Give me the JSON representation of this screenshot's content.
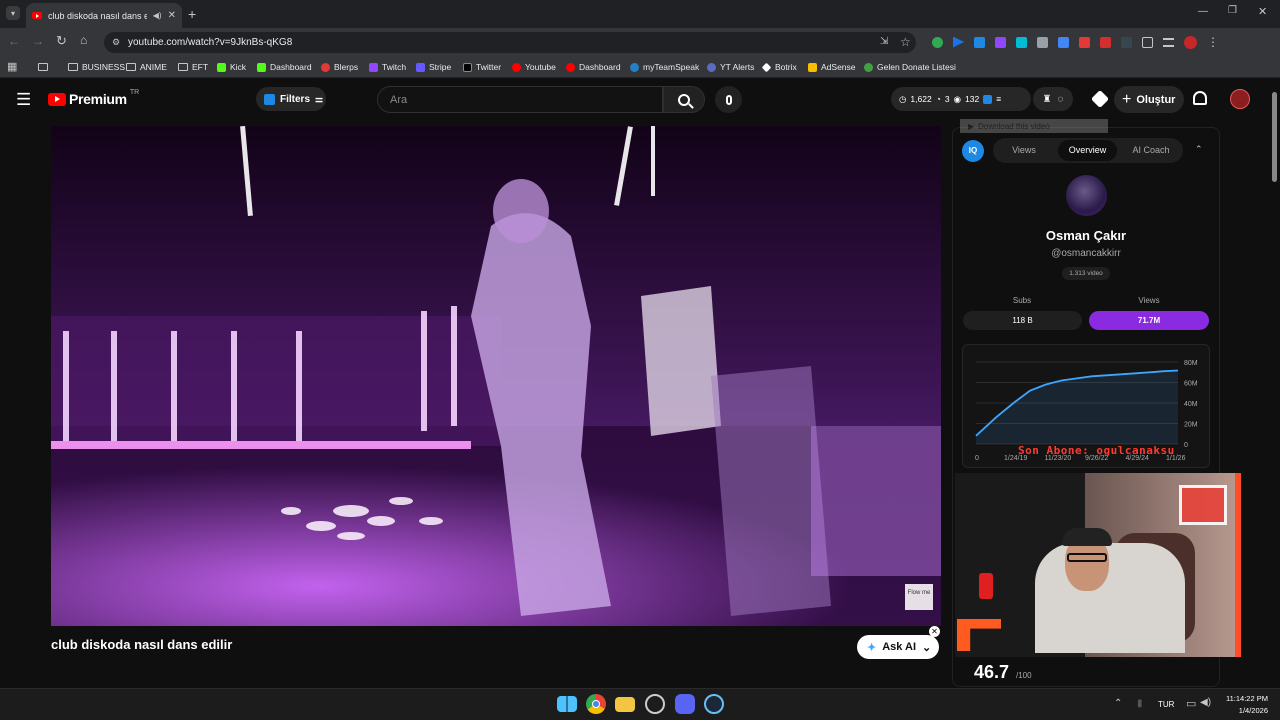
{
  "tab": {
    "title": "club diskoda nasıl dans edilir"
  },
  "address": {
    "url": "youtube.com/watch?v=9JknBs-qKG8"
  },
  "bookmarks": [
    "BUSINESS",
    "ANIME",
    "EFT",
    "Kick",
    "Dashboard",
    "Blerps",
    "Twitch",
    "Stripe",
    "Twitter",
    "Youtube",
    "Dashboard",
    "myTeamSpeak",
    "YT Alerts",
    "Botrix",
    "AdSense",
    "Gelen Donate Listesi"
  ],
  "youtube": {
    "logo": "Premium",
    "logo_sup": "TR",
    "filters_label": "Filters",
    "search_placeholder": "Ara",
    "stats": {
      "views": "1,622",
      "comments": "3",
      "watching": "132"
    },
    "create_label": "Oluştur"
  },
  "video": {
    "title": "club diskoda nasıl dans edilir",
    "watermark": "Flow me"
  },
  "ask_ai": {
    "label": "Ask AI"
  },
  "panel": {
    "download_label": "Download this video",
    "tabs": [
      "Views",
      "Overview",
      "AI Coach"
    ],
    "active_tab": "Overview",
    "channel_name": "Osman Çakır",
    "channel_handle": "@osmancakkirr",
    "video_count": "1.313 video",
    "subs_label": "Subs",
    "views_label": "Views",
    "subs_value": "118 B",
    "views_value": "71.7M",
    "score": "46.7",
    "score_max": "/100"
  },
  "chart_data": {
    "type": "area",
    "x": [
      "1/24/19",
      "11/23/20",
      "9/26/22",
      "4/29/24",
      "1/1/26"
    ],
    "y_ticks": [
      "80M",
      "60M",
      "40M",
      "20M",
      "0"
    ],
    "ylim": [
      0,
      80
    ],
    "start_label": "0",
    "series": [
      {
        "values": [
          8,
          26,
          40,
          52,
          58,
          62,
          64,
          66,
          67,
          68,
          69,
          70,
          71,
          71.7
        ]
      }
    ],
    "color": "#3ea6ff"
  },
  "overlay": {
    "subscriber_ticker": "Son Abone: ogulcanaksu"
  },
  "taskbar": {
    "lang": "TUR",
    "time": "11:14:22 PM",
    "date": "1/4/2026"
  }
}
